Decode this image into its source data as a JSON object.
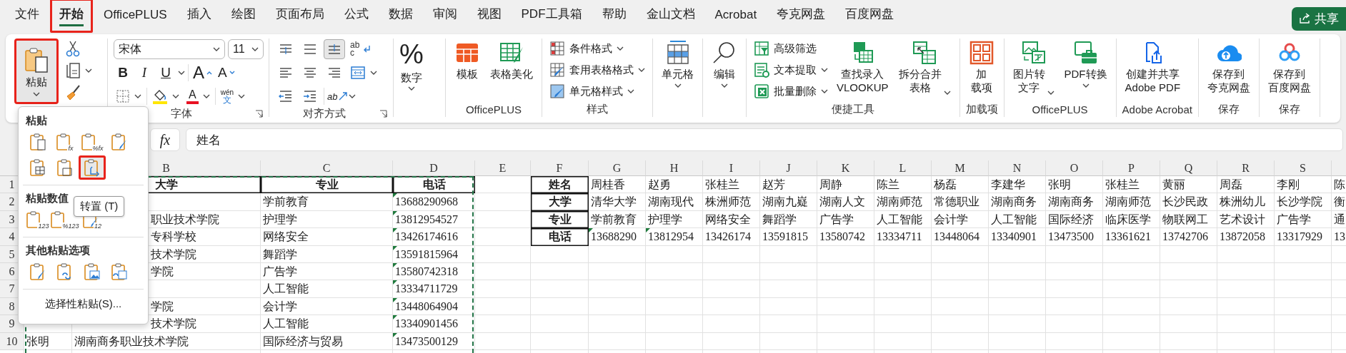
{
  "tabs": [
    {
      "label": "文件",
      "selected": false,
      "annotated": false
    },
    {
      "label": "开始",
      "selected": true,
      "annotated": true
    },
    {
      "label": "OfficePLUS",
      "selected": false,
      "annotated": false
    },
    {
      "label": "插入",
      "selected": false,
      "annotated": false
    },
    {
      "label": "绘图",
      "selected": false,
      "annotated": false
    },
    {
      "label": "页面布局",
      "selected": false,
      "annotated": false
    },
    {
      "label": "公式",
      "selected": false,
      "annotated": false
    },
    {
      "label": "数据",
      "selected": false,
      "annotated": false
    },
    {
      "label": "审阅",
      "selected": false,
      "annotated": false
    },
    {
      "label": "视图",
      "selected": false,
      "annotated": false
    },
    {
      "label": "PDF工具箱",
      "selected": false,
      "annotated": false
    },
    {
      "label": "帮助",
      "selected": false,
      "annotated": false
    },
    {
      "label": "金山文档",
      "selected": false,
      "annotated": false
    },
    {
      "label": "Acrobat",
      "selected": false,
      "annotated": false
    },
    {
      "label": "夸克网盘",
      "selected": false,
      "annotated": false
    },
    {
      "label": "百度网盘",
      "selected": false,
      "annotated": false
    }
  ],
  "share_button": "共享",
  "ribbon": {
    "paste": {
      "label": "粘贴",
      "pressed": true,
      "annotated": true
    },
    "font": {
      "label": "字体",
      "font_name": "宋体",
      "font_size": "11",
      "bold_key": "B",
      "italic_key": "I",
      "underline_key": "U",
      "grow_key": "A",
      "shrink_key": "A",
      "color_key": "A",
      "phonetic_top": "wén",
      "phonetic_bottom": "文"
    },
    "alignment": {
      "label": "对齐方式",
      "vertical": [
        {
          "selected": false
        },
        {
          "selected": false
        },
        {
          "selected": true
        }
      ],
      "wrap_top": "ab",
      "wrap_bottom": "c",
      "orientation_key": "ab"
    },
    "number": {
      "label": "数字",
      "symbol": "%"
    },
    "groups": [
      {
        "label": "OfficePLUS",
        "items": [
          {
            "kind": "large",
            "lines": [
              "模板"
            ],
            "caret": false
          },
          {
            "kind": "large",
            "lines": [
              "表格美化"
            ],
            "caret": false
          }
        ]
      },
      {
        "label": "样式",
        "items": [
          {
            "kind": "small",
            "lines": [
              "条件格式"
            ],
            "caret": true
          },
          {
            "kind": "small",
            "lines": [
              "套用表格格式"
            ],
            "caret": true
          },
          {
            "kind": "small",
            "lines": [
              "单元格样式"
            ],
            "caret": true
          }
        ]
      },
      {
        "items": [
          {
            "kind": "large",
            "lines": [
              "单元格"
            ],
            "caret": true
          }
        ]
      },
      {
        "items": [
          {
            "kind": "large",
            "lines": [
              "编辑"
            ],
            "caret": true
          }
        ]
      },
      {
        "label": "便捷工具",
        "items": [
          {
            "kind": "small",
            "lines": [
              "高级筛选"
            ],
            "caret": false
          },
          {
            "kind": "small",
            "lines": [
              "文本提取"
            ],
            "caret": true
          },
          {
            "kind": "small",
            "lines": [
              "批量删除"
            ],
            "caret": true
          },
          {
            "kind": "large",
            "lines": [
              "查找录入",
              "VLOOKUP"
            ],
            "caret": false
          },
          {
            "kind": "large",
            "lines": [
              "拆分合并",
              "表格"
            ],
            "caret": true
          }
        ]
      },
      {
        "label": "加载项",
        "items": [
          {
            "kind": "large",
            "lines": [
              "加",
              "载项"
            ],
            "caret": false
          }
        ]
      },
      {
        "label": "OfficePLUS",
        "items": [
          {
            "kind": "large",
            "lines": [
              "图片转",
              "文字"
            ],
            "caret": true
          },
          {
            "kind": "large",
            "lines": [
              "PDF转换"
            ],
            "caret": true
          }
        ]
      },
      {
        "label": "Adobe Acrobat",
        "items": [
          {
            "kind": "large",
            "lines": [
              "创建并共享",
              "Adobe PDF"
            ],
            "caret": false
          }
        ]
      },
      {
        "label": "保存",
        "items": [
          {
            "kind": "large",
            "lines": [
              "保存到",
              "夸克网盘"
            ],
            "caret": false
          }
        ]
      },
      {
        "label": "保存",
        "items": [
          {
            "kind": "large",
            "lines": [
              "保存到",
              "百度网盘"
            ],
            "caret": false
          }
        ]
      }
    ]
  },
  "formula_bar": {
    "function_key": "fx",
    "formula": "姓名"
  },
  "sheet": {
    "columns": [
      "B",
      "C",
      "D",
      "E",
      "F",
      "G",
      "H",
      "I",
      "J",
      "K",
      "L",
      "M",
      "N",
      "O",
      "P",
      "Q",
      "R",
      "S"
    ],
    "rows": [
      {
        "number": "1",
        "cells": {
          "b": {
            "text": "大学",
            "kind": "header"
          },
          "c": {
            "text": "专业",
            "kind": "header",
            "flagged": false
          },
          "d": {
            "text": "电话",
            "kind": "header",
            "flagged": false
          },
          "f": {
            "text": "姓名",
            "kind": "header",
            "flagged": false
          },
          "g": {
            "text": "周桂香",
            "kind": "value",
            "flagged": false
          },
          "h": {
            "text": "赵勇",
            "kind": "value",
            "flagged": false
          },
          "i": {
            "text": "张桂兰",
            "kind": "value",
            "flagged": false
          },
          "j": {
            "text": "赵芳",
            "kind": "value",
            "flagged": false
          },
          "k": {
            "text": "周静",
            "kind": "value",
            "flagged": false
          },
          "l": {
            "text": "陈兰",
            "kind": "value",
            "flagged": false
          },
          "m": {
            "text": "杨磊",
            "kind": "value",
            "flagged": false
          },
          "n": {
            "text": "李建华",
            "kind": "value",
            "flagged": false
          },
          "o": {
            "text": "张明",
            "kind": "value",
            "flagged": false
          },
          "p": {
            "text": "张桂兰",
            "kind": "value",
            "flagged": false
          },
          "q": {
            "text": "黄丽",
            "kind": "value",
            "flagged": false
          },
          "r": {
            "text": "周磊",
            "kind": "value",
            "flagged": false
          },
          "s": {
            "text": "李刚",
            "kind": "value",
            "flagged": false
          },
          "t": {
            "text": "陈",
            "kind": "value",
            "flagged": false
          }
        }
      },
      {
        "number": "2",
        "cells": {
          "c": {
            "text": "学前教育",
            "kind": "value",
            "flagged": false
          },
          "d": {
            "text": "13688290968",
            "kind": "value",
            "flagged": true
          },
          "f": {
            "text": "大学",
            "kind": "header",
            "flagged": false
          },
          "g": {
            "text": "清华大学",
            "kind": "value",
            "flagged": false
          },
          "h": {
            "text": "湖南现代",
            "kind": "value",
            "flagged": false
          },
          "i": {
            "text": "株洲师范",
            "kind": "value",
            "flagged": false
          },
          "j": {
            "text": "湖南九嶷",
            "kind": "value",
            "flagged": false
          },
          "k": {
            "text": "湖南人文",
            "kind": "value",
            "flagged": false
          },
          "l": {
            "text": "湖南师范",
            "kind": "value",
            "flagged": false
          },
          "m": {
            "text": "常德职业",
            "kind": "value",
            "flagged": false
          },
          "n": {
            "text": "湖南商务",
            "kind": "value",
            "flagged": false
          },
          "o": {
            "text": "湖南商务",
            "kind": "value",
            "flagged": false
          },
          "p": {
            "text": "湖南师范",
            "kind": "value",
            "flagged": false
          },
          "q": {
            "text": "长沙民政",
            "kind": "value",
            "flagged": false
          },
          "r": {
            "text": "株洲幼儿",
            "kind": "value",
            "flagged": false
          },
          "s": {
            "text": "长沙学院",
            "kind": "value",
            "flagged": false
          },
          "t": {
            "text": "衡",
            "kind": "value",
            "flagged": false
          }
        }
      },
      {
        "number": "3",
        "cells": {
          "b": {
            "text": "职业技术学院",
            "kind": "covered"
          },
          "c": {
            "text": "护理学",
            "kind": "value",
            "flagged": false
          },
          "d": {
            "text": "13812954527",
            "kind": "value",
            "flagged": true
          },
          "f": {
            "text": "专业",
            "kind": "header",
            "flagged": false
          },
          "g": {
            "text": "学前教育",
            "kind": "value",
            "flagged": false
          },
          "h": {
            "text": "护理学",
            "kind": "value",
            "flagged": false
          },
          "i": {
            "text": "网络安全",
            "kind": "value",
            "flagged": false
          },
          "j": {
            "text": "舞蹈学",
            "kind": "value",
            "flagged": false
          },
          "k": {
            "text": "广告学",
            "kind": "value",
            "flagged": false
          },
          "l": {
            "text": "人工智能",
            "kind": "value",
            "flagged": false
          },
          "m": {
            "text": "会计学",
            "kind": "value",
            "flagged": false
          },
          "n": {
            "text": "人工智能",
            "kind": "value",
            "flagged": false
          },
          "o": {
            "text": "国际经济",
            "kind": "value",
            "flagged": false
          },
          "p": {
            "text": "临床医学",
            "kind": "value",
            "flagged": false
          },
          "q": {
            "text": "物联网工",
            "kind": "value",
            "flagged": false
          },
          "r": {
            "text": "艺术设计",
            "kind": "value",
            "flagged": false
          },
          "s": {
            "text": "广告学",
            "kind": "value",
            "flagged": false
          },
          "t": {
            "text": "通",
            "kind": "value",
            "flagged": false
          }
        }
      },
      {
        "number": "4",
        "cells": {
          "b": {
            "text": "专科学校",
            "kind": "covered"
          },
          "c": {
            "text": "网络安全",
            "kind": "value",
            "flagged": false
          },
          "d": {
            "text": "13426174616",
            "kind": "value",
            "flagged": true
          },
          "f": {
            "text": "电话",
            "kind": "header",
            "flagged": false
          },
          "g": {
            "text": "13688290",
            "kind": "value",
            "flagged": true
          },
          "h": {
            "text": "13812954",
            "kind": "value",
            "flagged": true
          },
          "i": {
            "text": "13426174",
            "kind": "value",
            "flagged": false
          },
          "j": {
            "text": "13591815",
            "kind": "value",
            "flagged": false
          },
          "k": {
            "text": "13580742",
            "kind": "value",
            "flagged": false
          },
          "l": {
            "text": "13334711",
            "kind": "value",
            "flagged": false
          },
          "m": {
            "text": "13448064",
            "kind": "value",
            "flagged": false
          },
          "n": {
            "text": "13340901",
            "kind": "value",
            "flagged": false
          },
          "o": {
            "text": "13473500",
            "kind": "value",
            "flagged": false
          },
          "p": {
            "text": "13361621",
            "kind": "value",
            "flagged": false
          },
          "q": {
            "text": "13742706",
            "kind": "value",
            "flagged": false
          },
          "r": {
            "text": "13872058",
            "kind": "value",
            "flagged": false
          },
          "s": {
            "text": "13317929",
            "kind": "value",
            "flagged": false
          },
          "t": {
            "text": "13",
            "kind": "value",
            "flagged": false
          }
        }
      },
      {
        "number": "5",
        "cells": {
          "b": {
            "text": "技术学院",
            "kind": "covered"
          },
          "c": {
            "text": "舞蹈学",
            "kind": "value",
            "flagged": false
          },
          "d": {
            "text": "13591815964",
            "kind": "value",
            "flagged": true
          }
        }
      },
      {
        "number": "6",
        "cells": {
          "b": {
            "text": "学院",
            "kind": "covered"
          },
          "c": {
            "text": "广告学",
            "kind": "value",
            "flagged": false
          },
          "d": {
            "text": "13580742318",
            "kind": "value",
            "flagged": true
          }
        }
      },
      {
        "number": "7",
        "cells": {
          "c": {
            "text": "人工智能",
            "kind": "value",
            "flagged": false
          },
          "d": {
            "text": "13334711729",
            "kind": "value",
            "flagged": true
          }
        }
      },
      {
        "number": "8",
        "cells": {
          "b": {
            "text": "学院",
            "kind": "covered"
          },
          "c": {
            "text": "会计学",
            "kind": "value",
            "flagged": false
          },
          "d": {
            "text": "13448064904",
            "kind": "value",
            "flagged": true
          }
        }
      },
      {
        "number": "9",
        "cells": {
          "b": {
            "text": "技术学院",
            "kind": "covered"
          },
          "c": {
            "text": "人工智能",
            "kind": "value",
            "flagged": false
          },
          "d": {
            "text": "13340901456",
            "kind": "value",
            "flagged": true
          }
        }
      },
      {
        "number": "10",
        "cells": {
          "a": {
            "text": "张明",
            "kind": "value",
            "flagged": false
          },
          "b": {
            "text": "湖南商务职业技术学院",
            "kind": "value",
            "flagged": false
          },
          "c": {
            "text": "国际经济与贸易",
            "kind": "value",
            "flagged": false
          },
          "d": {
            "text": "13473500129",
            "kind": "value",
            "flagged": true
          }
        }
      }
    ]
  },
  "paste_menu": {
    "sections": [
      {
        "title": "粘贴",
        "options": [
          {
            "selected": false,
            "annotated": false
          },
          {
            "selected": false,
            "annotated": false,
            "badge": "fx"
          },
          {
            "selected": false,
            "annotated": false,
            "badge": "%fx"
          },
          {
            "selected": false,
            "annotated": false
          },
          {
            "selected": false,
            "annotated": false
          },
          {
            "selected": false,
            "annotated": false
          },
          {
            "selected": true,
            "annotated": true
          }
        ]
      },
      {
        "title": "粘贴数值",
        "options": [
          {
            "selected": false,
            "annotated": false,
            "badge": "123"
          },
          {
            "selected": false,
            "annotated": false,
            "badge": "%123"
          },
          {
            "selected": false,
            "annotated": false,
            "badge": "12"
          }
        ]
      },
      {
        "title": "其他粘贴选项",
        "options": [
          {
            "selected": false,
            "annotated": false
          },
          {
            "selected": false,
            "annotated": false
          },
          {
            "selected": false,
            "annotated": false
          },
          {
            "selected": false,
            "annotated": false
          }
        ]
      }
    ],
    "special": "选择性粘贴(S)...",
    "tooltip": "转置 (T)"
  }
}
